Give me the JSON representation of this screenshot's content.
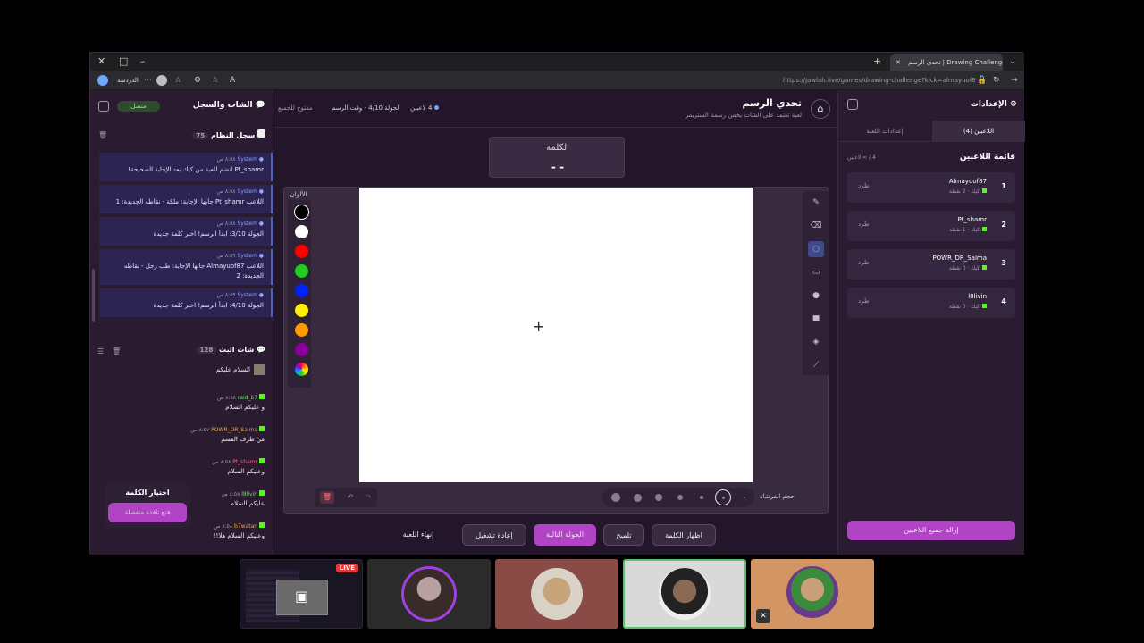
{
  "browser": {
    "tab_title": "تحدي الرسم | Drawing Challenge - جولة",
    "url": "https://jawlah.live/games/drawing-challenge?kick=almayuof87",
    "profile_label": "الدردشة",
    "new_tab": "+",
    "close": "✕",
    "minimize": "–",
    "restore": "□"
  },
  "header": {
    "game_title": "تحدي الرسم",
    "game_subtitle": "لعبة تعتمد على الشات يخمن رسمة الستريمر",
    "players_count": "4 لاعبين",
    "round_info": "الجولة 4/10 - وقت الرسم",
    "open_status": "مفتوح للجميع"
  },
  "word_box": {
    "label": "الكلمة",
    "value": "- -"
  },
  "colors_label": "الألوان",
  "palette": [
    "#000000",
    "#ffffff",
    "#ff0000",
    "#22cc22",
    "#0022ff",
    "#ffee00",
    "#ff9900",
    "#880099"
  ],
  "brush_size_label": "حجم الفرشاة",
  "controls": {
    "end_game": "إنهاء اللعبة",
    "restart": "إعادة تشغيل",
    "next_round": "الجولة التالية",
    "hint": "تلميح",
    "show_word": "اظهار الكلمة"
  },
  "chat_panel": {
    "title": "الشات والسجل",
    "connected": "متصل",
    "system_log_title": "سجل النظام",
    "system_log_count": "75",
    "stream_chat_title": "شات البث",
    "stream_chat_count": "128",
    "system_messages": [
      {
        "who": "System",
        "time": "٨:٥٨ ص",
        "text": "Pt_shamr انضم للعبة من كيك بعد الإجابة الصحيحة!"
      },
      {
        "who": "System",
        "time": "٨:٥٨ ص",
        "text": "اللاعب Pt_shamr جابها الإجابة: ملكة - نقاطه الجديدة: 1"
      },
      {
        "who": "System",
        "time": "٨:٥٨ ص",
        "text": "الجولة 3/10: ابدأ الرسم! اختر كلمة جديدة"
      },
      {
        "who": "System",
        "time": "٨:٥٩ ص",
        "text": "اللاعب Almayuof87 جابها الإجابة: طب رجل - نقاطه الجديدة: 2"
      },
      {
        "who": "System",
        "time": "٨:٥٩ ص",
        "text": "الجولة 4/10: ابدأ الرسم! اختر كلمة جديدة"
      }
    ],
    "chat_messages": [
      {
        "user": "",
        "time": "",
        "text": "السلام عليكم",
        "color": "#ffffff"
      },
      {
        "user": "raid_b7",
        "time": "٨:٥٨ ص",
        "text": "و عليكم السلام",
        "color": "#7fd27f"
      },
      {
        "user": "POWR_DR_Salma",
        "time": "٨:٥٧ ص",
        "text": "من طرف القسم",
        "color": "#f0a63a"
      },
      {
        "user": "Pt_shamr",
        "time": "٨:٥٨ ص",
        "text": "وعليكم السلام",
        "color": "#ff5c8a"
      },
      {
        "user": "l8livin",
        "time": "٨:٥٨ ص",
        "text": "عليكم السلام",
        "color": "#7fd27f"
      },
      {
        "user": "b7watan",
        "time": "٨:٥٨ ص",
        "text": "وعليكم السلام هلا!!",
        "color": "#f0a63a"
      }
    ],
    "pick_word_title": "اختيار الكلمة",
    "pick_word_button": "فتح نافذة منفصلة"
  },
  "settings_panel": {
    "title": "الإعدادات",
    "tab_players": "اللاعبين (4)",
    "tab_game_settings": "إعدادات اللعبة",
    "players_list_title": "قائمة اللاعبين",
    "players_list_count": "4 / ∞ لاعبين",
    "kick_label": "طرد",
    "players": [
      {
        "rank": "1",
        "name": "Almayuof87",
        "score": "كيك · 2 نقطة"
      },
      {
        "rank": "2",
        "name": "Pt_shamr",
        "score": "كيك · 1 نقطة"
      },
      {
        "rank": "3",
        "name": "POWR_DR_Salma",
        "score": "كيك · 0 نقطة"
      },
      {
        "rank": "4",
        "name": "l8livin",
        "score": "كيك · 0 نقطة"
      }
    ],
    "remove_all_button": "إزالة جميع اللاعبين"
  },
  "call_tiles": {
    "live_badge": "LIVE"
  },
  "accent_colors": {
    "purple": "#b044c4",
    "kick_green": "#53fc18",
    "system_blue": "#4b63c8"
  }
}
